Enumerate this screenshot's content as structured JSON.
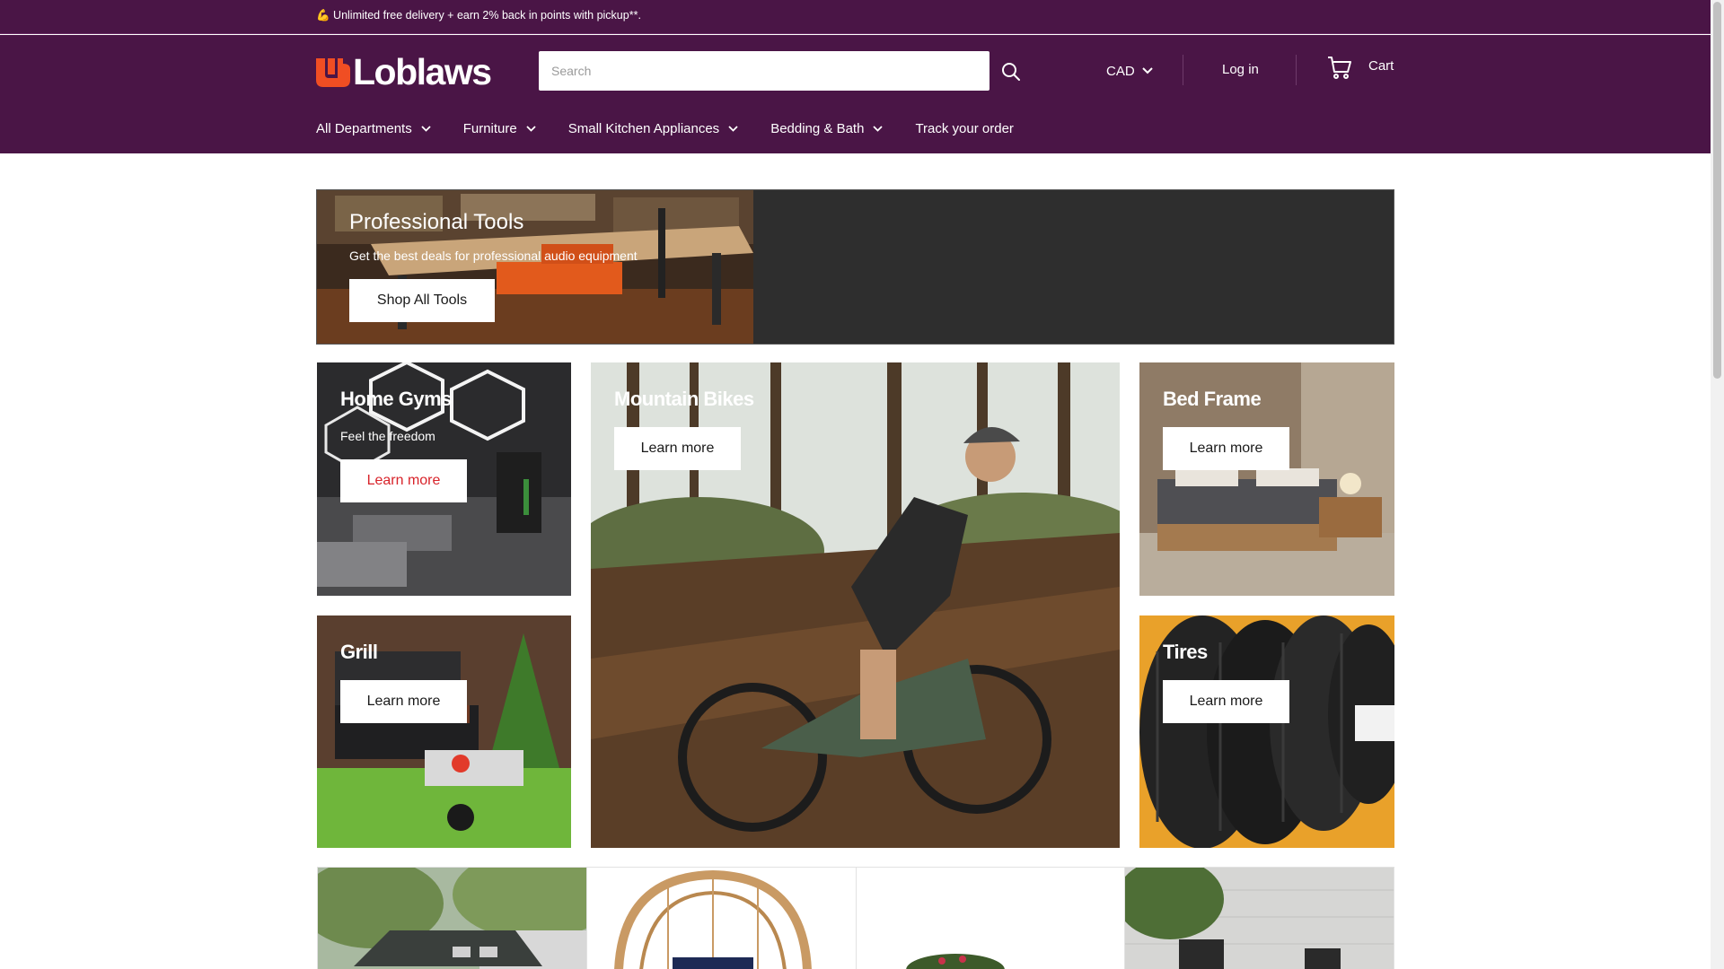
{
  "announcement": {
    "icon": "flexed-biceps-emoji",
    "text": "💪 Unlimited free delivery + earn 2% back in points with pickup**."
  },
  "header": {
    "logo_text": "Loblaws",
    "search": {
      "placeholder": "Search",
      "value": ""
    },
    "currency": "CAD",
    "login": "Log in",
    "cart": "Cart"
  },
  "nav": {
    "items": [
      {
        "label": "All Departments",
        "has_dropdown": true
      },
      {
        "label": "Furniture",
        "has_dropdown": true
      },
      {
        "label": "Small Kitchen Appliances",
        "has_dropdown": true
      },
      {
        "label": "Bedding & Bath",
        "has_dropdown": true
      },
      {
        "label": "Track your order",
        "has_dropdown": false
      }
    ]
  },
  "hero": {
    "title": "Professional Tools",
    "subtitle": "Get the best deals for professional audio equipment",
    "button": "Shop All Tools"
  },
  "tiles": {
    "home_gyms": {
      "title": "Home Gyms",
      "subtitle": "Feel the freedom",
      "button": "Learn more"
    },
    "mountain_bikes": {
      "title": "Mountain Bikes",
      "button": "Learn more"
    },
    "bed_frame": {
      "title": "Bed Frame",
      "button": "Learn more"
    },
    "grill": {
      "title": "Grill",
      "button": "Learn more"
    },
    "tires": {
      "title": "Tires",
      "button": "Learn more"
    }
  },
  "colors": {
    "header_bg": "#4a1546",
    "accent_red": "#d8232a",
    "banner_bg": "#2e2e2e"
  }
}
